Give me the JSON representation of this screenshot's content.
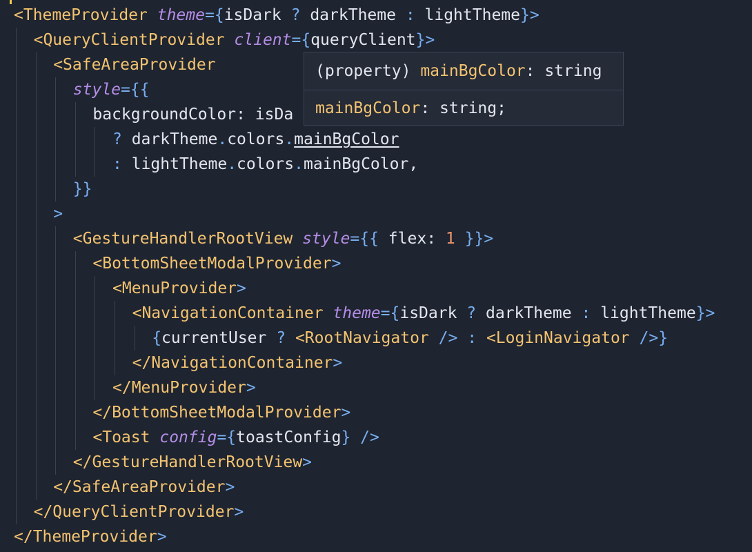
{
  "editor": {
    "lines": [
      [
        [
          "tag",
          "<ThemeProvider"
        ],
        [
          "ws",
          " "
        ],
        [
          "attr",
          "theme"
        ],
        [
          "punct",
          "={"
        ],
        [
          "ident",
          "isDark "
        ],
        [
          "op",
          "?"
        ],
        [
          "ident",
          " darkTheme "
        ],
        [
          "op",
          ":"
        ],
        [
          "ident",
          " lightTheme"
        ],
        [
          "punct",
          "}>"
        ]
      ],
      [
        [
          "tag",
          "<QueryClientProvider"
        ],
        [
          "ws",
          " "
        ],
        [
          "attr",
          "client"
        ],
        [
          "punct",
          "={"
        ],
        [
          "ident",
          "queryClient"
        ],
        [
          "punct",
          "}>"
        ]
      ],
      [
        [
          "tag",
          "<SafeAreaProvider"
        ]
      ],
      [
        [
          "attr",
          "style"
        ],
        [
          "punct",
          "={{"
        ]
      ],
      [
        [
          "ident",
          "backgroundColor: isDa"
        ]
      ],
      [
        [
          "op",
          "?"
        ],
        [
          "ident",
          " darkTheme"
        ],
        [
          "op",
          "."
        ],
        [
          "ident",
          "colors"
        ],
        [
          "op",
          "."
        ],
        [
          "link",
          "mainBgColor"
        ]
      ],
      [
        [
          "op",
          ":"
        ],
        [
          "ident",
          " lightTheme"
        ],
        [
          "op",
          "."
        ],
        [
          "ident",
          "colors"
        ],
        [
          "op",
          "."
        ],
        [
          "ident",
          "mainBgColor,"
        ]
      ],
      [
        [
          "punct",
          "}}"
        ]
      ],
      [
        [
          "punct",
          ">"
        ]
      ],
      [
        [
          "tag",
          "<GestureHandlerRootView"
        ],
        [
          "ws",
          " "
        ],
        [
          "attr",
          "style"
        ],
        [
          "punct",
          "={{"
        ],
        [
          "ident",
          " flex: "
        ],
        [
          "num",
          "1"
        ],
        [
          "punct",
          " }}>"
        ]
      ],
      [
        [
          "tag",
          "<BottomSheetModalProvider"
        ],
        [
          "punct",
          ">"
        ]
      ],
      [
        [
          "tag",
          "<MenuProvider"
        ],
        [
          "punct",
          ">"
        ]
      ],
      [
        [
          "tag",
          "<NavigationContainer"
        ],
        [
          "ws",
          " "
        ],
        [
          "attr",
          "theme"
        ],
        [
          "punct",
          "={"
        ],
        [
          "ident",
          "isDark "
        ],
        [
          "op",
          "?"
        ],
        [
          "ident",
          " darkTheme "
        ],
        [
          "op",
          ":"
        ],
        [
          "ident",
          " lightTheme"
        ],
        [
          "punct",
          "}>"
        ]
      ],
      [
        [
          "punct",
          "{"
        ],
        [
          "ident",
          "currentUser "
        ],
        [
          "op",
          "?"
        ],
        [
          "ws",
          " "
        ],
        [
          "tag",
          "<RootNavigator"
        ],
        [
          "punct",
          " />"
        ],
        [
          "ws",
          " "
        ],
        [
          "op",
          ":"
        ],
        [
          "ws",
          " "
        ],
        [
          "tag",
          "<LoginNavigator"
        ],
        [
          "punct",
          " />}"
        ]
      ],
      [
        [
          "tag",
          "</NavigationContainer"
        ],
        [
          "punct",
          ">"
        ]
      ],
      [
        [
          "tag",
          "</MenuProvider"
        ],
        [
          "punct",
          ">"
        ]
      ],
      [
        [
          "tag",
          "</BottomSheetModalProvider"
        ],
        [
          "punct",
          ">"
        ]
      ],
      [
        [
          "tag",
          "<Toast"
        ],
        [
          "ws",
          " "
        ],
        [
          "attr",
          "config"
        ],
        [
          "punct",
          "={"
        ],
        [
          "ident",
          "toastConfig"
        ],
        [
          "punct",
          "}"
        ],
        [
          "punct",
          " />"
        ]
      ],
      [
        [
          "tag",
          "</GestureHandlerRootView"
        ],
        [
          "punct",
          ">"
        ]
      ],
      [
        [
          "tag",
          "</SafeAreaProvider"
        ],
        [
          "punct",
          ">"
        ]
      ],
      [
        [
          "tag",
          "</QueryClientProvider"
        ],
        [
          "punct",
          ">"
        ]
      ],
      [
        [
          "tag",
          "</ThemeProvider"
        ],
        [
          "punct",
          ">"
        ]
      ]
    ]
  },
  "hover_tooltip": {
    "signature_prefix": "(property) ",
    "signature_name": "mainBgColor",
    "signature_suffix": ": string",
    "doc_name": "mainBgColor",
    "doc_suffix": ": string;"
  },
  "colors": {
    "background": "#1e2430",
    "tag": "#f3c370",
    "punctuation": "#78aef0",
    "attribute": "#b58de6",
    "identifier": "#e3e6ee",
    "number": "#f0946c"
  }
}
